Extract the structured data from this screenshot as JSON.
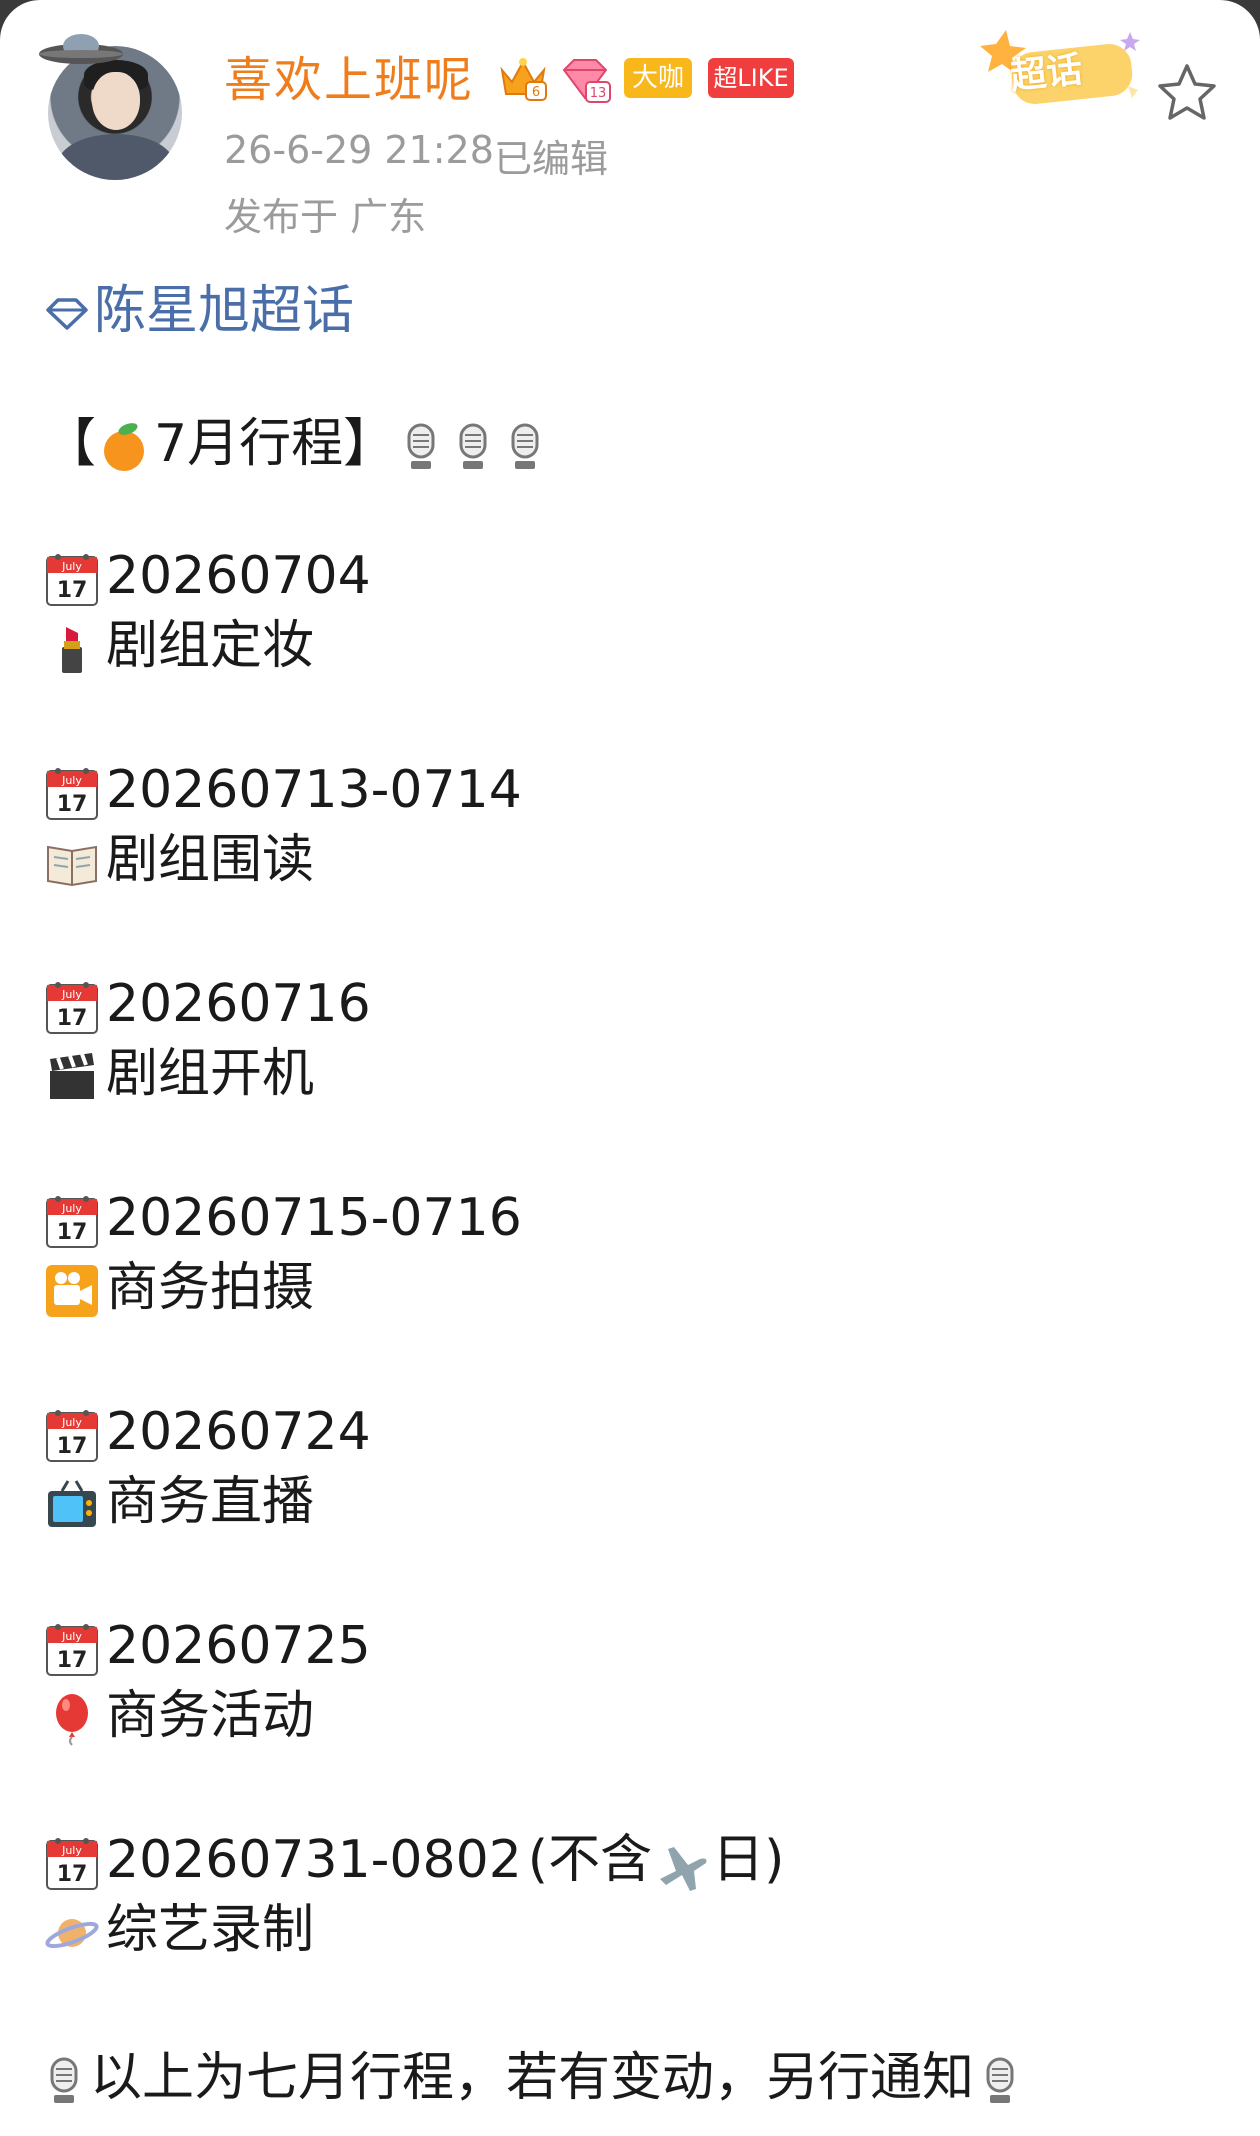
{
  "post": {
    "username": "喜欢上班呢",
    "badges": {
      "crown_level": "6",
      "gem_level": "13",
      "daka": "大咖",
      "super_like": "超LIKE"
    },
    "timestamp": "26-6-29 21:28",
    "edited": "已编辑",
    "location": "发布于 广东",
    "chaohua_label": "超话",
    "topic": "陈星旭超话",
    "heading": {
      "text": "7月行程】",
      "open_bracket": "【"
    },
    "schedule": [
      {
        "date": "20260704",
        "event": "剧组定妆",
        "icon": "lipstick-icon"
      },
      {
        "date": "20260713-0714",
        "event": "剧组围读",
        "icon": "book-icon"
      },
      {
        "date": "20260716",
        "event": "剧组开机",
        "icon": "clapper-icon"
      },
      {
        "date": "20260715-0716",
        "event": "商务拍摄",
        "icon": "movie-camera-icon"
      },
      {
        "date": "20260724",
        "event": "商务直播",
        "icon": "tv-icon"
      },
      {
        "date": "20260725",
        "event": "商务活动",
        "icon": "balloon-icon"
      },
      {
        "date": "20260731-0802",
        "date_note_prefix": "(不含",
        "date_note_suffix": "日)",
        "event": "综艺录制",
        "icon": "planet-icon"
      }
    ],
    "calendar_icon_text": {
      "month": "July",
      "day": "17"
    },
    "footer": "以上为七月行程，若有变动，另行通知"
  },
  "colors": {
    "username": "#ef7d1c",
    "meta": "#9b9b9b",
    "topic": "#4a6ea8",
    "text": "#1a1a1a",
    "daka_bg": "#f8b81b",
    "like_bg": "#f03e3e"
  }
}
